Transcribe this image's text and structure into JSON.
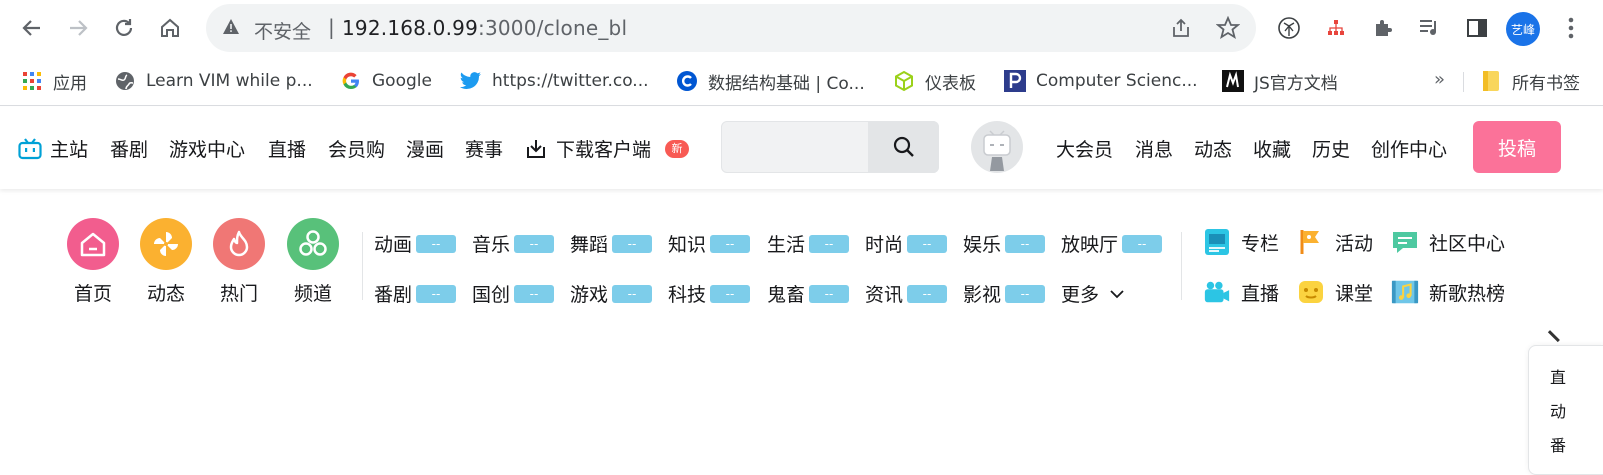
{
  "browser": {
    "security_label": "不安全",
    "separator": "|",
    "url_host": "192.168.0.99",
    "url_rest": ":3000/clone_bl",
    "profile_initials": "艺峰"
  },
  "bookmarks": [
    {
      "label": "应用",
      "icon": "apps-grid-icon"
    },
    {
      "label": "Learn VIM while p...",
      "icon": "globe-icon"
    },
    {
      "label": "Google",
      "icon": "google-icon"
    },
    {
      "label": "https://twitter.co...",
      "icon": "twitter-icon"
    },
    {
      "label": "数据结构基础 | Co...",
      "icon": "coursera-icon"
    },
    {
      "label": "仪表板",
      "icon": "cube-icon"
    },
    {
      "label": "Computer Scienc...",
      "icon": "p-logo-icon"
    },
    {
      "label": "JS官方文档",
      "icon": "m-logo-icon"
    }
  ],
  "bookmarks_more": "»",
  "bookmarks_folder": "所有书签",
  "header": {
    "nav": [
      {
        "label": "主站"
      },
      {
        "label": "番剧"
      },
      {
        "label": "游戏中心"
      },
      {
        "label": "直播"
      },
      {
        "label": "会员购"
      },
      {
        "label": "漫画"
      },
      {
        "label": "赛事"
      }
    ],
    "download_label": "下载客户端",
    "new_badge": "新",
    "search_placeholder": "",
    "user_links": [
      {
        "label": "大会员"
      },
      {
        "label": "消息"
      },
      {
        "label": "动态"
      },
      {
        "label": "收藏"
      },
      {
        "label": "历史"
      },
      {
        "label": "创作中心"
      }
    ],
    "upload_label": "投稿"
  },
  "channels": {
    "primary": [
      {
        "label": "首页",
        "color": "#f25d8e",
        "icon": "home-icon"
      },
      {
        "label": "动态",
        "color": "#fbb130",
        "icon": "pinwheel-icon"
      },
      {
        "label": "热门",
        "color": "#f07775",
        "icon": "flame-icon"
      },
      {
        "label": "频道",
        "color": "#58c17a",
        "icon": "channels-icon"
      }
    ],
    "categories_row1": [
      {
        "label": "动画",
        "count": "--"
      },
      {
        "label": "音乐",
        "count": "--"
      },
      {
        "label": "舞蹈",
        "count": "--"
      },
      {
        "label": "知识",
        "count": "--"
      },
      {
        "label": "生活",
        "count": "--"
      },
      {
        "label": "时尚",
        "count": "--"
      },
      {
        "label": "娱乐",
        "count": "--"
      },
      {
        "label": "放映厅",
        "count": "--"
      }
    ],
    "categories_row2": [
      {
        "label": "番剧",
        "count": "--"
      },
      {
        "label": "国创",
        "count": "--"
      },
      {
        "label": "游戏",
        "count": "--"
      },
      {
        "label": "科技",
        "count": "--"
      },
      {
        "label": "鬼畜",
        "count": "--"
      },
      {
        "label": "资讯",
        "count": "--"
      },
      {
        "label": "影视",
        "count": "--"
      }
    ],
    "more_label": "更多",
    "side_links": [
      {
        "label": "专栏",
        "icon": "column-icon"
      },
      {
        "label": "活动",
        "icon": "flag-icon"
      },
      {
        "label": "社区中心",
        "icon": "chat-icon"
      },
      {
        "label": "直播",
        "icon": "camera-icon"
      },
      {
        "label": "课堂",
        "icon": "class-icon"
      },
      {
        "label": "新歌热榜",
        "icon": "music-chart-icon"
      }
    ]
  },
  "float_panel": {
    "items": [
      {
        "label": "直"
      },
      {
        "label": "动"
      },
      {
        "label": "番"
      }
    ]
  },
  "colors": {
    "accent": "#fb7299",
    "bili_blue": "#00a1d6",
    "count_bg": "#7dcdea"
  }
}
